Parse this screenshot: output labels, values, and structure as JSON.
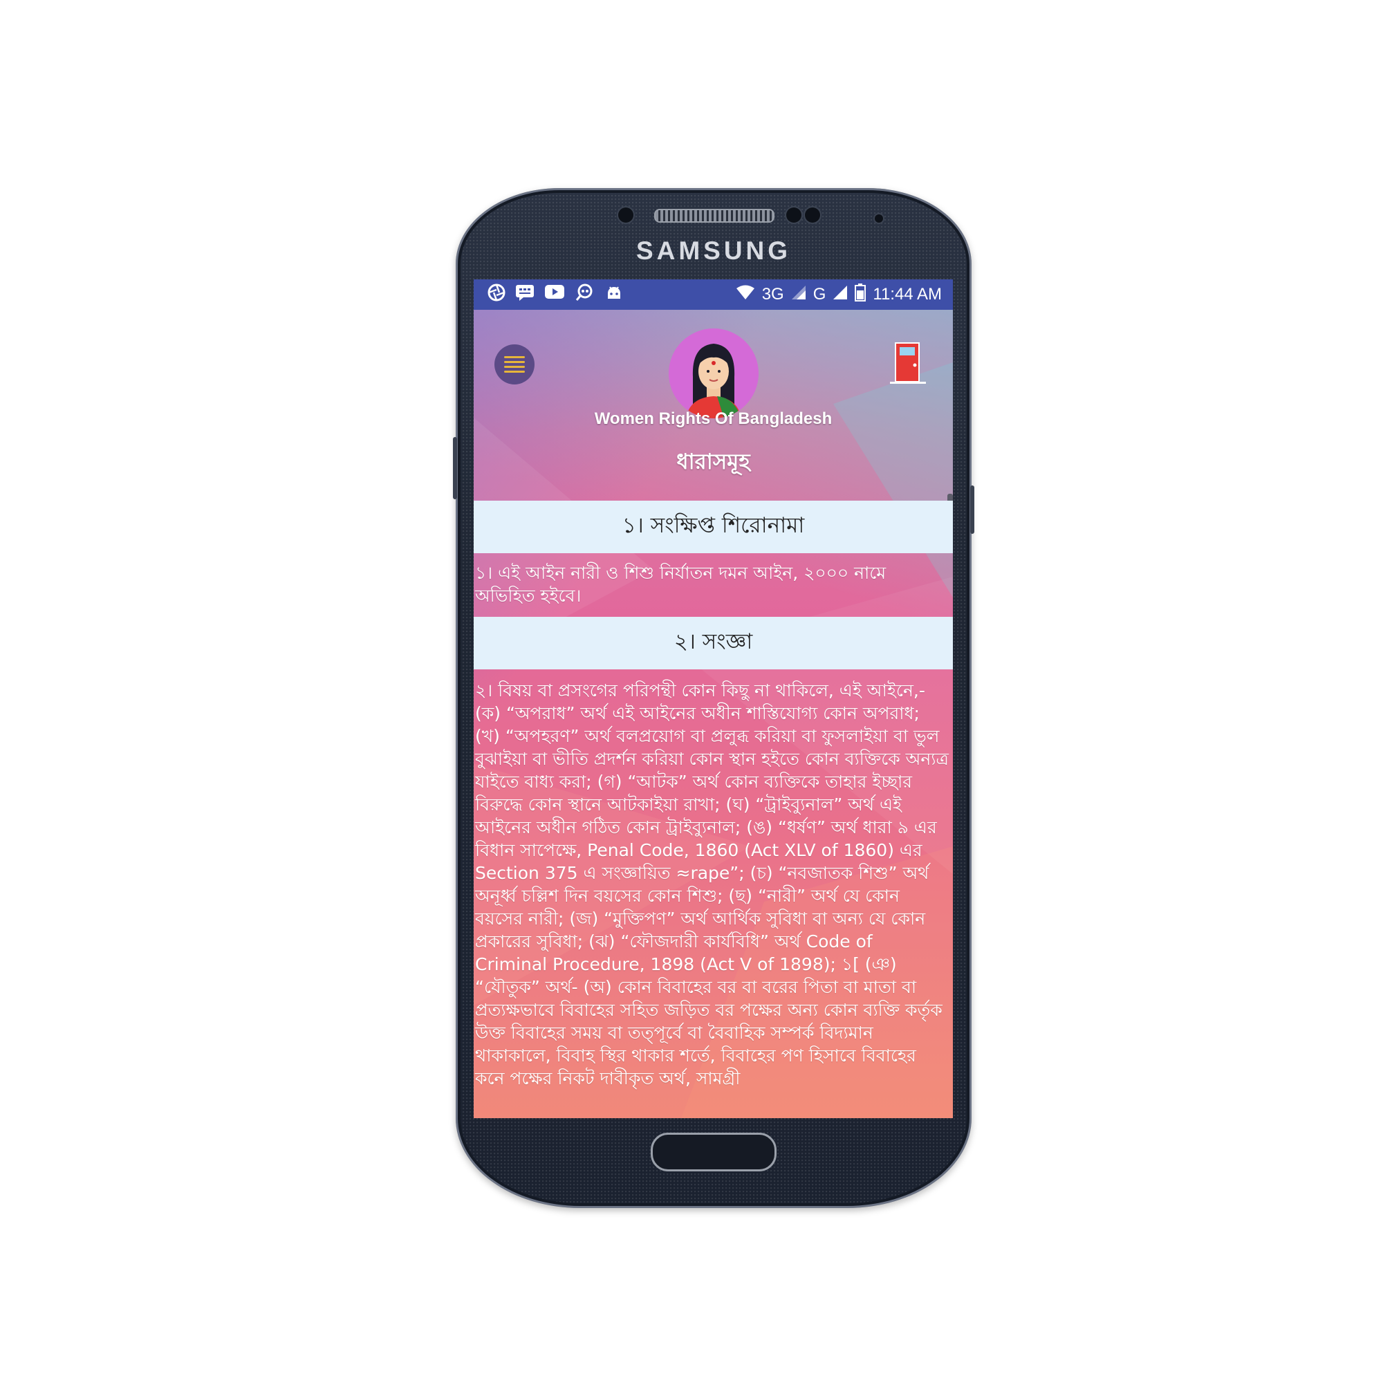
{
  "device": {
    "brand": "SAMSUNG"
  },
  "status_bar": {
    "icons": [
      "camera-aperture-icon",
      "chat-icon",
      "youtube-icon",
      "search-app-icon",
      "android-icon"
    ],
    "network_3g": "3G",
    "network_g": "G",
    "time": "11:44 AM"
  },
  "app": {
    "title": "Women Rights Of Bangladesh",
    "section_heading": "ধারাসমূহ",
    "items": [
      {
        "title": "১। সংক্ষিপ্ত শিরোনামা",
        "body": "১। এই আইন নারী ও শিশু নির্যাতন দমন আইন, ২০০০ নামে অভিহিত হইবে।"
      },
      {
        "title": "২। সংজ্ঞা",
        "body": "২। বিষয় বা প্রসংগের পরিপন্থী কোন কিছু না থাকিলে, এই আইনে,- (ক) “অপরাধ” অর্থ এই আইনের অধীন শাস্তিযোগ্য কোন অপরাধ; (খ) “অপহরণ” অর্থ বলপ্রয়োগ বা প্রলুব্ধ করিয়া বা ফুসলাইয়া বা ভুল বুঝাইয়া বা ভীতি প্রদর্শন করিয়া কোন স্থান হইতে কোন ব্যক্তিকে অন্যত্র যাইতে বাধ্য করা; (গ) “আটক” অর্থ কোন ব্যক্তিকে তাহার ইচ্ছার বিরুদ্ধে কোন স্থানে আটকাইয়া রাখা; (ঘ) “ট্রাইব্যুনাল” অর্থ এই আইনের অধীন গঠিত কোন ট্রাইব্যুনাল; (ঙ) “ধর্ষণ” অর্থ ধারা ৯ এর বিধান সাপেক্ষে, Penal Code, 1860 (Act XLV of 1860) এর Section 375 এ সংজ্ঞায়িত ≈rape”; (চ) “নবজাতক শিশু” অর্থ অনূর্ধ্ব চল্লিশ দিন বয়সের কোন শিশু; (ছ) “নারী” অর্থ যে কোন বয়সের নারী; (জ) “মুক্তিপণ” অর্থ আর্থিক সুবিধা বা অন্য যে কোন প্রকারের সুবিধা; (ঝ) “ফৌজদারী কার্যবিধি” অর্থ Code of Criminal Procedure, 1898 (Act V of 1898); ১[ (ঞ) “যৌতুক” অর্থ- (অ) কোন বিবাহের বর বা বরের পিতা বা মাতা বা প্রত্যক্ষভাবে বিবাহের সহিত জড়িত বর পক্ষের অন্য কোন ব্যক্তি কর্তৃক উক্ত বিবাহের সময় বা তত্পূর্বে বা বৈবাহিক সম্পর্ক বিদ্যমান থাকাকালে, বিবাহ স্থির থাকার শর্তে, বিবাহের পণ হিসাবে বিবাহের কনে পক্ষের নিকট দাবীকৃত অর্থ, সামগ্রী"
      }
    ]
  },
  "colors": {
    "status_bar": "#3e4fa8",
    "item_title_bg": "#e3f1fb",
    "menu_button": "#5b4a86",
    "menu_lines": "#e6b53a",
    "avatar_bg": "#d46ad7",
    "door": "#e53935"
  }
}
